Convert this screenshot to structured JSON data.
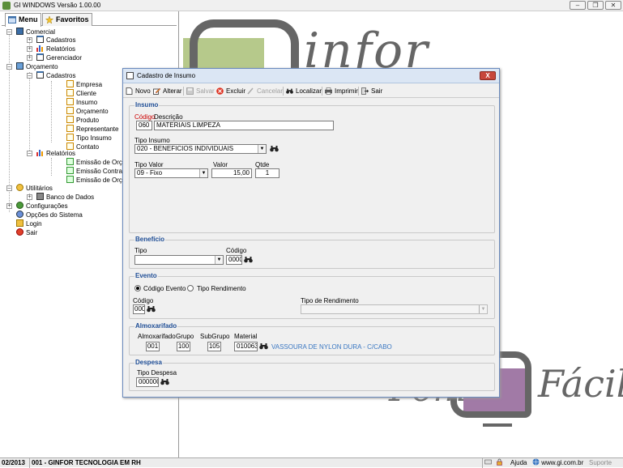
{
  "app": {
    "title": "GI WINDOWS  Versão  1.00.00"
  },
  "tabs": {
    "menu": "Menu",
    "favoritos": "Favoritos"
  },
  "tree": {
    "comercial": "Comercial",
    "cadastros1": "Cadastros",
    "relatorios1": "Relatórios",
    "gerenciador": "Gerenciador",
    "orcamento": "Orçamento",
    "cadastros2": "Cadastros",
    "empresa": "Empresa",
    "cliente": "Cliente",
    "insumo": "Insumo",
    "orcamento_item": "Orçamento",
    "produto": "Produto",
    "representante": "Representante",
    "tipo_insumo": "Tipo Insumo",
    "contato": "Contato",
    "relatorios2": "Relatórios",
    "emissao_orc1": "Emissão de Orçam",
    "emissao_contrato": "Emissão Contrato",
    "emissao_orc2": "Emissão de Orçam",
    "utilitarios": "Utilitários",
    "banco_dados": "Banco de Dados",
    "configuracoes": "Configurações",
    "opcoes": "Opções do Sistema",
    "login": "Login",
    "sair": "Sair"
  },
  "logo": {
    "text1": "infor",
    "text2a": "Fom",
    "text2b": "Fácil"
  },
  "dialog": {
    "title": "Cadastro de Insumo",
    "close": "X",
    "toolbar": {
      "novo": "Novo",
      "alterar": "Alterar",
      "salvar": "Salvar",
      "excluir": "Excluir",
      "cancelar": "Cancelar",
      "localizar": "Localizar",
      "imprimir": "Imprimir",
      "sair": "Sair"
    },
    "insumo": {
      "legend": "Insumo",
      "codigo_label": "Código",
      "codigo": "060",
      "descricao_label": "Descrição",
      "descricao": "MATERIAIS LIMPEZA",
      "tipo_insumo_label": "Tipo Insumo",
      "tipo_insumo": "020 - BENEFICIOS INDIVIDUAIS",
      "tipo_valor_label": "Tipo Valor",
      "tipo_valor": "09 - Fixo",
      "valor_label": "Valor",
      "valor": "15,00",
      "qtde_label": "Qtde",
      "qtde": "1"
    },
    "beneficio": {
      "legend": "Benefício",
      "tipo_label": "Tipo",
      "tipo": "",
      "codigo_label": "Código",
      "codigo": "0000"
    },
    "evento": {
      "legend": "Evento",
      "radio1": "Código Evento",
      "radio2": "Tipo Rendimento",
      "codigo_label": "Código",
      "codigo": "000",
      "tipo_rend_label": "Tipo de Rendimento",
      "tipo_rend": ""
    },
    "almoxarifado": {
      "legend": "Almoxarifado",
      "almox_label": "Almoxarifado",
      "almox": "001",
      "grupo_label": "Grupo",
      "grupo": "100",
      "subgrupo_label": "SubGrupo",
      "subgrupo": "105",
      "material_label": "Material",
      "material": "010063",
      "material_desc": "VASSOURA DE NYLON DURA - C/CABO"
    },
    "despesa": {
      "legend": "Despesa",
      "tipo_label": "Tipo Despesa",
      "tipo": "000000"
    }
  },
  "status": {
    "periodo": "02/2013",
    "empresa": "001 - GINFOR TECNOLOGIA EM RH",
    "ajuda": "Ajuda",
    "site": "www.gi.com.br",
    "suporte": "Suporte"
  },
  "colors": {
    "legend": "#1f4e96",
    "accent_green": "#b6c98b",
    "accent_purple": "#a17aa6",
    "link": "#3a77c2"
  }
}
